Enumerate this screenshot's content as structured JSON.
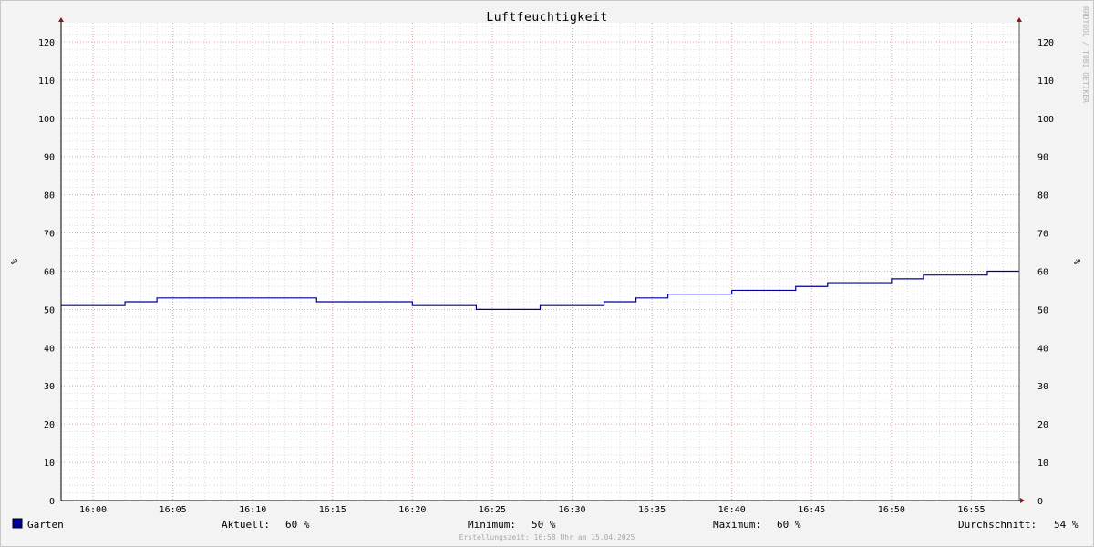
{
  "chart_data": {
    "type": "line",
    "title": "Luftfeuchtigkeit",
    "ylabel": "%",
    "ylim": [
      0,
      125
    ],
    "y_ticks": [
      0,
      10,
      20,
      30,
      40,
      50,
      60,
      70,
      80,
      90,
      100,
      110,
      120
    ],
    "x_range": [
      "15:58",
      "16:58"
    ],
    "x_ticks": [
      "16:00",
      "16:05",
      "16:10",
      "16:15",
      "16:20",
      "16:25",
      "16:30",
      "16:35",
      "16:40",
      "16:45",
      "16:50",
      "16:55"
    ],
    "grid": true,
    "legend_position": "bottom-left",
    "series": [
      {
        "name": "Garten",
        "color": "#000099",
        "step": true,
        "x": [
          "15:58",
          "16:02",
          "16:04",
          "16:14",
          "16:20",
          "16:24",
          "16:28",
          "16:32",
          "16:34",
          "16:36",
          "16:40",
          "16:44",
          "16:46",
          "16:50",
          "16:52",
          "16:56",
          "16:58"
        ],
        "y": [
          51,
          52,
          53,
          52,
          51,
          50,
          51,
          52,
          53,
          54,
          55,
          56,
          57,
          58,
          59,
          60,
          60
        ]
      }
    ],
    "watermark": "RRDTOOL / TOBI OETIKER"
  },
  "legend": {
    "series_name": "Garten",
    "color": "#000099",
    "aktuell_label": "Aktuell:",
    "aktuell_value": "60 %",
    "minimum_label": "Minimum:",
    "minimum_value": "50 %",
    "maximum_label": "Maximum:",
    "maximum_value": "60 %",
    "durchschnitt_label": "Durchschnitt:",
    "durchschnitt_value": "54 %"
  },
  "footer": "Erstellungszeit: 16:58 Uhr am 15.04.2025"
}
